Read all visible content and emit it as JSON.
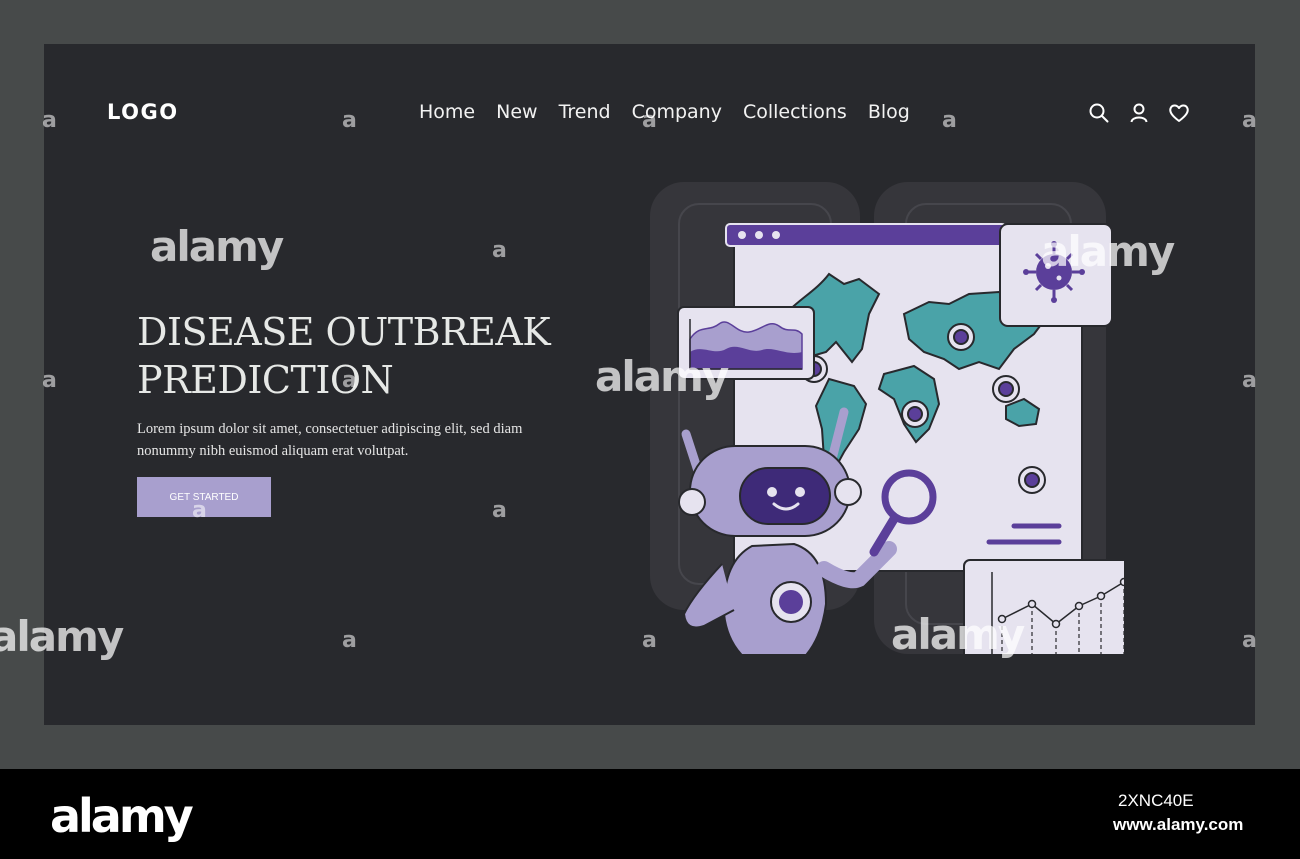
{
  "header": {
    "logo": "LOGO",
    "nav": [
      "Home",
      "New",
      "Trend",
      "Company",
      "Collections",
      "Blog"
    ],
    "icons": [
      "search-icon",
      "user-icon",
      "heart-icon"
    ]
  },
  "hero": {
    "title": "DISEASE OUTBREAK PREDICTION",
    "description": "Lorem ipsum dolor sit amet, consectetuer adipiscing elit, sed diam nonummy nibh euismod aliquam erat volutpat.",
    "cta": "GET STARTED"
  },
  "watermark": {
    "text": "alamy",
    "letter": "a",
    "image_id": "2XNC40E",
    "url": "www.alamy.com"
  },
  "colors": {
    "background": "#474a4a",
    "panel": "#28292d",
    "accent": "#a89fce",
    "purple": "#5b3f9a",
    "teal": "#4aa3a8",
    "lavender": "#e6e3ef"
  }
}
